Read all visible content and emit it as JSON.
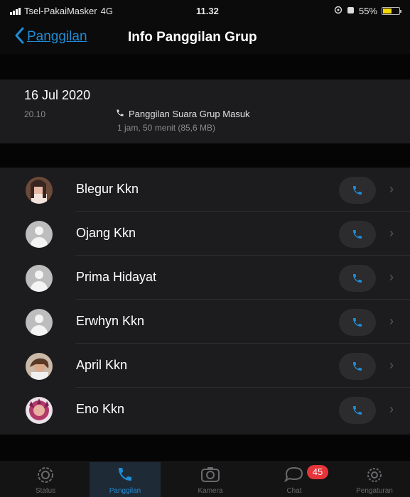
{
  "status_bar": {
    "carrier": "Tsel-PakaiMasker",
    "network": "4G",
    "time": "11.32",
    "battery": "55%",
    "battery_level": 0.55
  },
  "nav": {
    "back_label": "Panggilan",
    "title": "Info Panggilan Grup"
  },
  "call_info": {
    "date": "16 Jul 2020",
    "time": "20.10",
    "type": "Panggilan Suara Grup Masuk",
    "duration": "1 jam, 50 menit (85,6 MB)"
  },
  "participants": [
    {
      "name": "Blegur Kkn",
      "avatar": "photo"
    },
    {
      "name": "Ojang Kkn",
      "avatar": "default"
    },
    {
      "name": "Prima Hidayat",
      "avatar": "default"
    },
    {
      "name": "Erwhyn Kkn",
      "avatar": "default"
    },
    {
      "name": "April Kkn",
      "avatar": "photo"
    },
    {
      "name": "Eno Kkn",
      "avatar": "photo"
    }
  ],
  "tabs": [
    {
      "label": "Status",
      "icon": "status-icon"
    },
    {
      "label": "Panggilan",
      "icon": "phone-icon"
    },
    {
      "label": "Kamera",
      "icon": "camera-icon"
    },
    {
      "label": "Chat",
      "icon": "chat-icon",
      "badge": "45"
    },
    {
      "label": "Pengaturan",
      "icon": "gear-icon"
    }
  ],
  "colors": {
    "accent": "#1f8dd6",
    "background": "#000000",
    "cell": "#1c1c1e",
    "badge": "#e5353a"
  }
}
